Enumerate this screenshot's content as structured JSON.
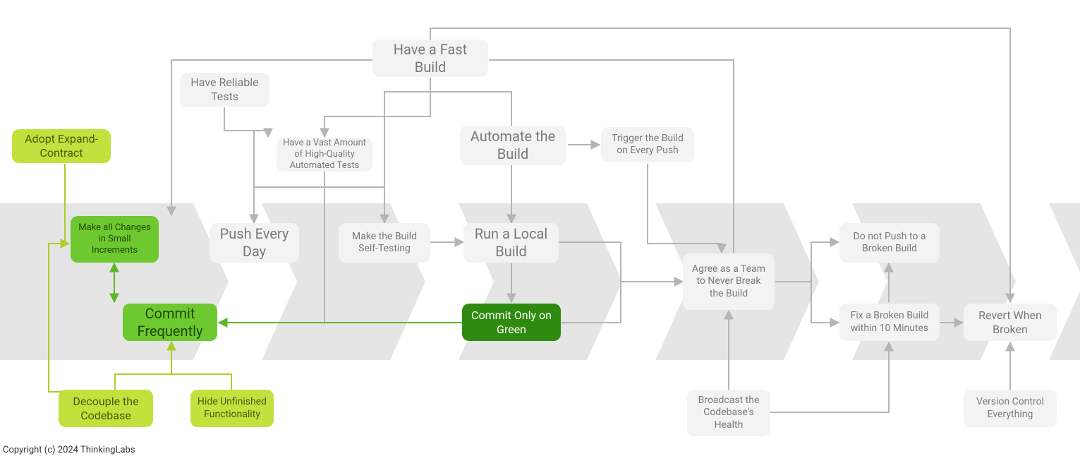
{
  "copyright": "Copyright (c) 2024 ThinkingLabs",
  "nodes": {
    "adopt_expand_contract": "Adopt Expand-Contract",
    "make_all_changes": "Make all Changes in Small Increments",
    "commit_frequently": "Commit Frequently",
    "decouple_codebase": "Decouple the Codebase",
    "hide_unfinished": "Hide Unfinished Functionality",
    "have_reliable_tests": "Have Reliable Tests",
    "push_every_day": "Push Every Day",
    "have_vast_tests": "Have a Vast Amount of  High-Quality Automated Tests",
    "make_build_selftest": "Make the Build Self-Testing",
    "have_fast_build": "Have a Fast Build",
    "automate_build": "Automate the Build",
    "run_local_build": "Run a Local Build",
    "commit_only_green": "Commit Only on Green",
    "trigger_build_push": "Trigger the Build on Every Push",
    "agree_never_break": "Agree as a Team to Never Break the Build",
    "broadcast_health": "Broadcast the Codebase's Health",
    "do_not_push_broken": "Do not Push to a Broken Build",
    "fix_broken_10min": "Fix a Broken Build within 10 Minutes",
    "revert_when_broken": "Revert When Broken",
    "version_control": "Version Control Everything"
  }
}
